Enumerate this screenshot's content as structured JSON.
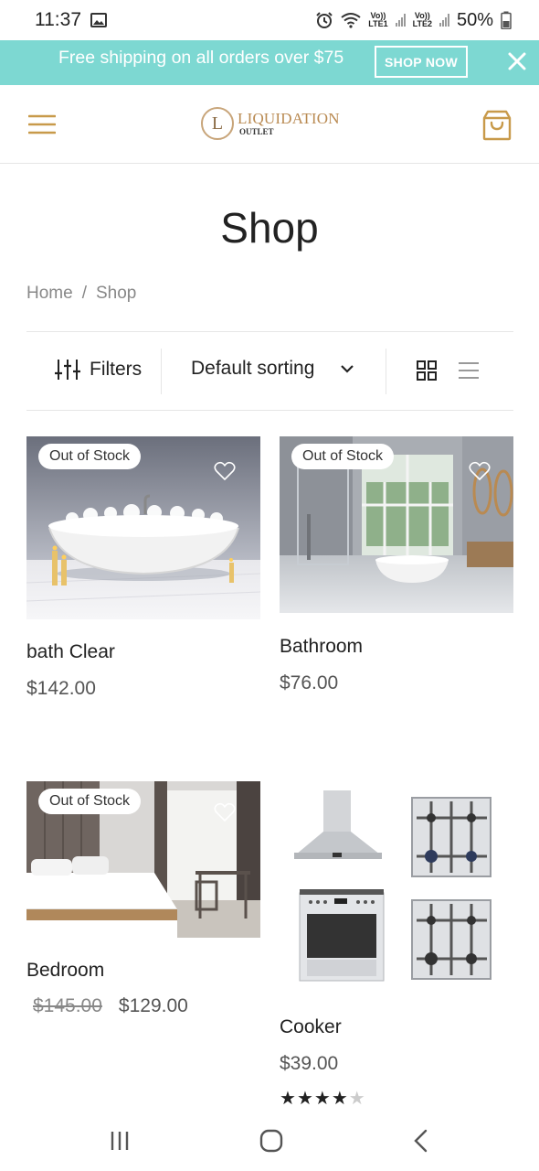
{
  "status_bar": {
    "time": "11:37",
    "sim1_volte": "Vo))",
    "sim1_lte": "LTE1",
    "sim2_volte": "Vo))",
    "sim2_lte": "LTE2",
    "battery": "50%"
  },
  "promo": {
    "text": "Free shipping on all orders over $75",
    "button": "SHOP NOW",
    "close_icon": "close-icon"
  },
  "header": {
    "logo_title": "LIQUIDATION",
    "logo_sub": "OUTLET",
    "logo_mark": "L",
    "menu_icon": "hamburger-icon",
    "cart_icon": "shopping-bag-icon"
  },
  "page": {
    "title": "Shop",
    "breadcrumb": [
      "Home",
      "/",
      "Shop"
    ]
  },
  "toolbar": {
    "filters_label": "Filters",
    "sorting_label": "Default sorting",
    "colors": {
      "accent": "#c89a4a",
      "banner": "#7dd8d2"
    }
  },
  "products": [
    {
      "name": "bath Clear",
      "badge": "Out of Stock",
      "price": "$142.00",
      "old_price": null
    },
    {
      "name": "Bathroom",
      "badge": "Out of Stock",
      "price": "$76.00",
      "old_price": null
    },
    {
      "name": "Bedroom",
      "badge": "Out of Stock",
      "price": "$129.00",
      "old_price": "$145.00"
    },
    {
      "name": "Cooker",
      "badge": null,
      "price": "$39.00",
      "old_price": null,
      "rating": 4,
      "rating_max": 5
    }
  ]
}
